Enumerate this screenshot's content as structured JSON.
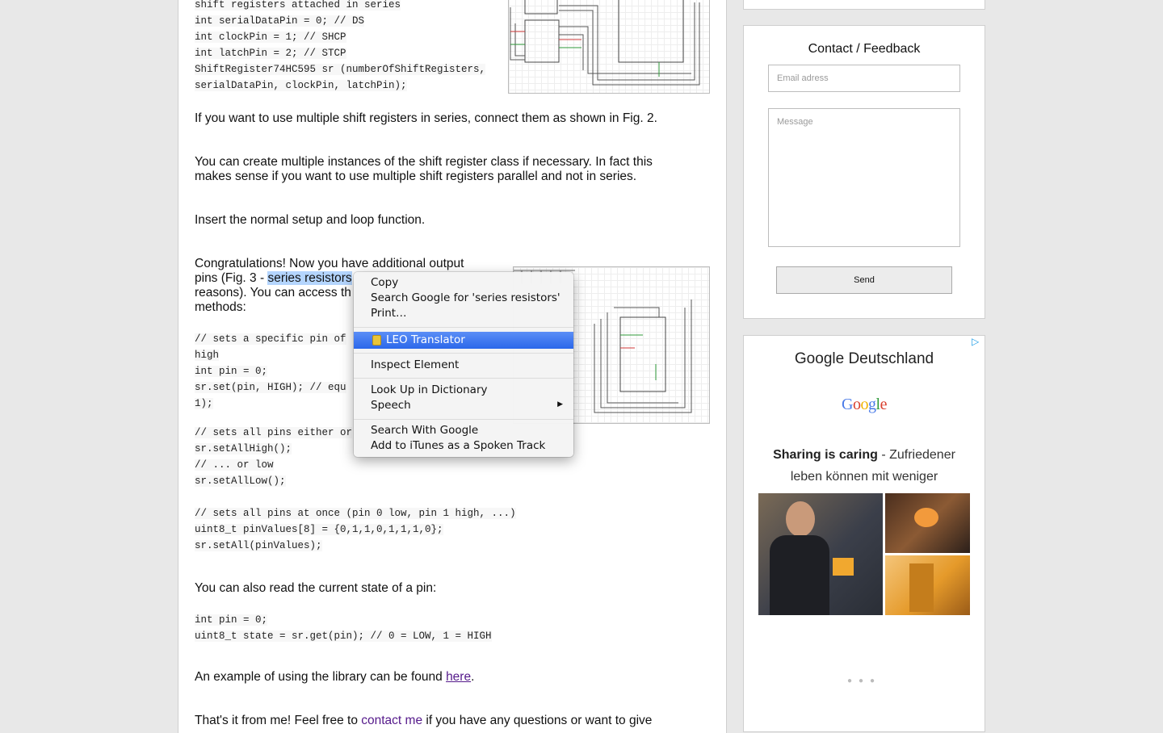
{
  "article": {
    "code1": [
      "shift registers attached in series",
      "int serialDataPin = 0; // DS",
      "int clockPin = 1; // SHCP",
      "int latchPin = 2; // STCP",
      "ShiftRegister74HC595 sr (numberOfShiftRegisters,",
      "serialDataPin, clockPin, latchPin);"
    ],
    "para_multiple": "If you want to use multiple shift registers in series, connect them as shown in Fig. 2.",
    "para_instances": "You can create multiple instances of the shift register class if necessary. In fact this makes sense if you want to use multiple shift registers parallel and not in series.",
    "para_setup": "Insert the normal setup and loop function.",
    "para_congrats_1": "Congratulations! Now you have additional output",
    "para_congrats_2_pre": "pins (Fig. 3 - ",
    "para_congrats_2_sel": "series resistors",
    "para_congrats_3": "reasons). You can access th",
    "para_congrats_4": "methods:",
    "code2": [
      "// sets a specific pin of",
      "high",
      "int pin = 0;",
      "sr.set(pin, HIGH); // equ",
      "1);"
    ],
    "code3": [
      "// sets all pins either or",
      "sr.setAllHigh();",
      "// ... or low",
      "sr.setAllLow();"
    ],
    "code4": [
      "// sets all pins at once (pin 0 low, pin 1 high, ...)",
      "uint8_t pinValues[8] = {0,1,1,0,1,1,1,0};",
      "sr.setAll(pinValues);"
    ],
    "para_read": "You can also read the current state of a pin:",
    "code5": [
      "int pin = 0;",
      "uint8_t state = sr.get(pin); // 0 = LOW, 1 = HIGH"
    ],
    "para_example_pre": "An example of using the library can be found ",
    "para_example_link": "here",
    "para_example_post": ".",
    "para_end_pre": "That's it from me! Feel free to ",
    "para_end_link": "contact me",
    "para_end_post": " if you have any questions or want to give"
  },
  "sidebar": {
    "contact_title": "Contact / Feedback",
    "email_placeholder": "Email adress",
    "message_placeholder": "Message",
    "send_label": "Send",
    "ad": {
      "title": "Google Deutschland",
      "logo_text": "Google",
      "text_bold": "Sharing is caring",
      "text_rest": " - Zufriedener leben können mit weniger"
    }
  },
  "context_menu": {
    "copy": "Copy",
    "search_google_for": "Search Google for 'series resistors'",
    "print": "Print…",
    "leo": "LEO Translator",
    "inspect": "Inspect Element",
    "look_up": "Look Up in Dictionary",
    "speech": "Speech",
    "search_with_google": "Search With Google",
    "add_itunes": "Add to iTunes as a Spoken Track"
  },
  "colors": {
    "menu_highlight": "#2b67ea",
    "selection": "#b4d5fe",
    "link": "#551a8b",
    "adchoices": "#1a9be6"
  }
}
